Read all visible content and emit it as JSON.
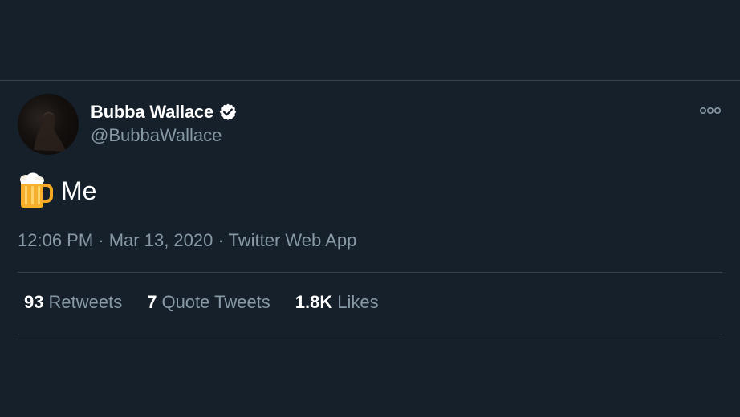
{
  "author": {
    "display_name": "Bubba Wallace",
    "handle": "@BubbaWallace",
    "verified": true
  },
  "tweet": {
    "emoji": "beer-mug-icon",
    "text": "Me",
    "time": "12:06 PM",
    "separator1": " · ",
    "date": "Mar 13, 2020",
    "separator2": " · ",
    "source": "Twitter Web App"
  },
  "stats": {
    "retweets_count": "93",
    "retweets_label": "Retweets",
    "quotes_count": "7",
    "quotes_label": "Quote Tweets",
    "likes_count": "1.8K",
    "likes_label": "Likes"
  },
  "colors": {
    "background": "#15202b",
    "divider": "#38444d",
    "secondary_text": "#8899a6",
    "primary_text": "#ffffff"
  }
}
